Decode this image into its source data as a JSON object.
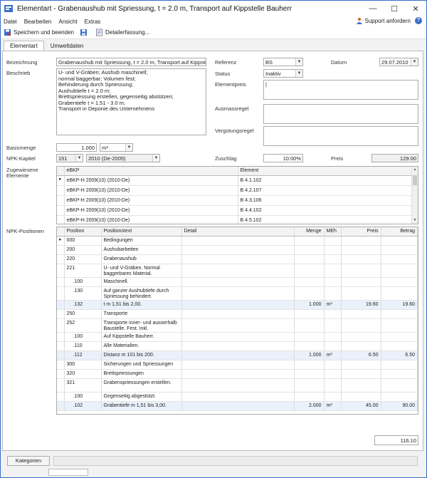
{
  "window": {
    "title": "Elementart - Grabenaushub mit Spriessung, t = 2.0 m, Transport auf Kippstelle Bauherr",
    "minimize": "—",
    "maximize": "☐",
    "close": "✕"
  },
  "menu": {
    "items": [
      "Datei",
      "Bearbeiten",
      "Ansicht",
      "Extras"
    ],
    "support": "Support anfordern",
    "help": "?"
  },
  "toolbar": {
    "save_close": "Speichern und beenden",
    "detail": "Detailerfassung..."
  },
  "tabs": [
    "Elementart",
    "Umweltdaten"
  ],
  "form": {
    "bezeichnung_label": "Bezeichnung",
    "bezeichnung_value": "Grabenaushub mit Spriessung, t = 2.0 m, Transport auf Kippstelle",
    "beschrieb_label": "Beschrieb",
    "beschrieb_value": "U- und V-Gräben; Aushub maschinell;\nnormal baggerbar; Volumen fest;\nBehinderung durch Spriessung;\nAushubtiefe t = 2.0 m;\nBrettspriessung erstellen, gegenseitig abstützen;\nGrabentiefe t = 1.51 - 3.0 m;\nTransport in Deponie des Unternehmens",
    "referenz_label": "Referenz",
    "referenz_value": "BS",
    "datum_label": "Datum",
    "datum_value": "29.07.2010",
    "status_label": "Status",
    "status_value": "Inaktiv",
    "elementpreis_label": "Elementpreis",
    "elementpreis_value": "|",
    "ausmassregel_label": "Ausmassregel",
    "verguetungsregel_label": "Vergütungsregel",
    "basismenge_label": "Basismenge",
    "basismenge_value": "1.000",
    "basismenge_unit": "m³",
    "npk_kapitel_label": "NPK-Kapitel",
    "npk_kapitel_num": "151",
    "npk_kapitel_value": "2010 (De-2005)",
    "zuschlag_label": "Zuschlag",
    "zuschlag_value": "10.00%",
    "preis_label": "Preis",
    "preis_value": "129.00",
    "zugewiesene_label": "Zugewiesene",
    "elemente_label": "Elemente",
    "npk_positionen_label": "NPK-Positionen",
    "total_value": "116.10"
  },
  "ebkp_grid": {
    "headers": [
      "eBKP",
      "Element"
    ],
    "rows": [
      {
        "ebkp": "eBKP-H 2009(10) (2010-De)",
        "element": "B 4.1.102"
      },
      {
        "ebkp": "eBKP-H 2009(10) (2010-De)",
        "element": "B 4.2.107"
      },
      {
        "ebkp": "eBKP-H 2009(10) (2010-De)",
        "element": "B 4.3.106"
      },
      {
        "ebkp": "eBKP-H 2009(10) (2010-De)",
        "element": "B 4.4.102"
      },
      {
        "ebkp": "eBKP-H 2009(10) (2010-De)",
        "element": "B 4.5.102"
      }
    ]
  },
  "npk_grid": {
    "headers": [
      "Position",
      "Positionstext",
      "Detail",
      "Menge",
      "MEh",
      "Preis",
      "Betrag"
    ],
    "rows": [
      {
        "pos": "000",
        "text": "Bedingungen",
        "menge": "",
        "meh": "",
        "preis": "",
        "betrag": ""
      },
      {
        "pos": "200",
        "text": "Aushubarbeiten",
        "menge": "",
        "meh": "",
        "preis": "",
        "betrag": ""
      },
      {
        "pos": "220",
        "text": "Grabenaushub",
        "menge": "",
        "meh": "",
        "preis": "",
        "betrag": ""
      },
      {
        "pos": "221",
        "text": "U- und V-Gräben. Normal baggerbares Material.",
        "menge": "",
        "meh": "",
        "preis": "",
        "betrag": ""
      },
      {
        "pos": ".100",
        "text": "Maschinell.",
        "menge": "",
        "meh": "",
        "preis": "",
        "betrag": ""
      },
      {
        "pos": ".130",
        "text": "Auf ganzer Aushubtiefe durch Spriessung behindert.",
        "menge": "",
        "meh": "",
        "preis": "",
        "betrag": ""
      },
      {
        "pos": ".132",
        "text": "t m 1,51 bis 2,00.",
        "menge": "1.000",
        "meh": "m³",
        "preis": "19.60",
        "betrag": "19.60"
      },
      {
        "pos": "250",
        "text": "Transporte",
        "menge": "",
        "meh": "",
        "preis": "",
        "betrag": ""
      },
      {
        "pos": "252",
        "text": "Transporte inner- und ausserhalb Baustelle. Fest. Inkl.",
        "menge": "",
        "meh": "",
        "preis": "",
        "betrag": ""
      },
      {
        "pos": ".100",
        "text": "Auf Kippstelle Bauherr.",
        "menge": "",
        "meh": "",
        "preis": "",
        "betrag": ""
      },
      {
        "pos": ".110",
        "text": "Alle Materialien.",
        "menge": "",
        "meh": "",
        "preis": "",
        "betrag": ""
      },
      {
        "pos": ".112",
        "text": "Distanz m 101 bis 200.",
        "menge": "1.000",
        "meh": "m³",
        "preis": "6.50",
        "betrag": "6.50"
      },
      {
        "pos": "300",
        "text": "Sicherungen und Spriessungen",
        "menge": "",
        "meh": "",
        "preis": "",
        "betrag": ""
      },
      {
        "pos": "320",
        "text": "Brettspriessungen",
        "menge": "",
        "meh": "",
        "preis": "",
        "betrag": ""
      },
      {
        "pos": "321",
        "text": "Grabenspriessungen erstellen.",
        "menge": "",
        "meh": "",
        "preis": "",
        "betrag": ""
      },
      {
        "pos": ".100",
        "text": "Gegenseitig abgestützt.",
        "menge": "",
        "meh": "",
        "preis": "",
        "betrag": ""
      },
      {
        "pos": ".102",
        "text": "Grabentiefe m 1,51 bis 3,00.",
        "menge": "2.000",
        "meh": "m³",
        "preis": "45.00",
        "betrag": "90.00"
      }
    ]
  },
  "footer": {
    "kategorien": "Kategorien"
  }
}
